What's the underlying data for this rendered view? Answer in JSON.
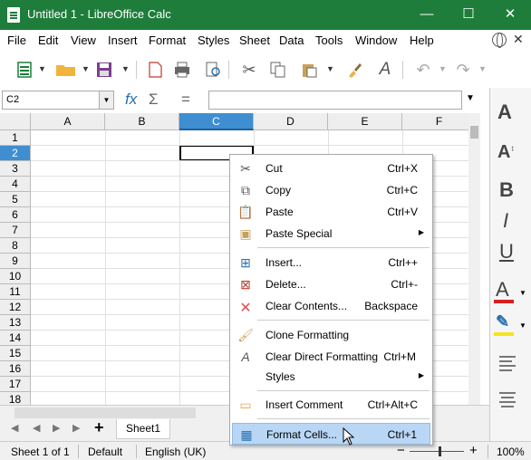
{
  "window": {
    "title": "Untitled 1 - LibreOffice Calc",
    "min": "—",
    "max": "☐",
    "close": "✕"
  },
  "menu": [
    "File",
    "Edit",
    "View",
    "Insert",
    "Format",
    "Styles",
    "Sheet",
    "Data",
    "Tools",
    "Window",
    "Help"
  ],
  "namebox": {
    "value": "C2"
  },
  "formula": {
    "fx": "fx",
    "sum": "Σ",
    "eq": "="
  },
  "columns": [
    "A",
    "B",
    "C",
    "D",
    "E",
    "F"
  ],
  "rows": [
    "1",
    "2",
    "3",
    "4",
    "5",
    "6",
    "7",
    "8",
    "9",
    "10",
    "11",
    "12",
    "13",
    "14",
    "15",
    "16",
    "17",
    "18"
  ],
  "selected_cell": "C2",
  "context_menu": [
    {
      "label": "Cut",
      "key": "Ctrl+X",
      "icon": "scissors-icon"
    },
    {
      "label": "Copy",
      "key": "Ctrl+C",
      "icon": "copy-icon"
    },
    {
      "label": "Paste",
      "key": "Ctrl+V",
      "icon": "paste-icon"
    },
    {
      "label": "Paste Special",
      "key": "",
      "icon": "paste-special-icon",
      "submenu": true
    },
    {
      "label": "Insert...",
      "key": "Ctrl++",
      "icon": "insert-cells-icon"
    },
    {
      "label": "Delete...",
      "key": "Ctrl+-",
      "icon": "delete-cells-icon"
    },
    {
      "label": "Clear Contents...",
      "key": "Backspace",
      "icon": "clear-x-icon"
    },
    {
      "label": "Clone Formatting",
      "key": "",
      "icon": "paintbrush-icon"
    },
    {
      "label": "Clear Direct Formatting",
      "key": "Ctrl+M",
      "icon": "clear-format-icon"
    },
    {
      "label": "Styles",
      "key": "",
      "icon": "",
      "submenu": true
    },
    {
      "label": "Insert Comment",
      "key": "Ctrl+Alt+C",
      "icon": "comment-icon"
    },
    {
      "label": "Format Cells...",
      "key": "Ctrl+1",
      "icon": "format-cells-icon",
      "highlighted": true
    }
  ],
  "sheets": {
    "tab": "Sheet1",
    "add": "+"
  },
  "status": {
    "sheet": "Sheet 1 of 1",
    "style": "Default",
    "language": "English (UK)",
    "zoom_minus": "−",
    "zoom_plus": "+",
    "zoom": "100%"
  },
  "colors": {
    "titlebar": "#1e7d3b",
    "selection": "#3f8ed1",
    "highlight": "#b9d7f5"
  }
}
